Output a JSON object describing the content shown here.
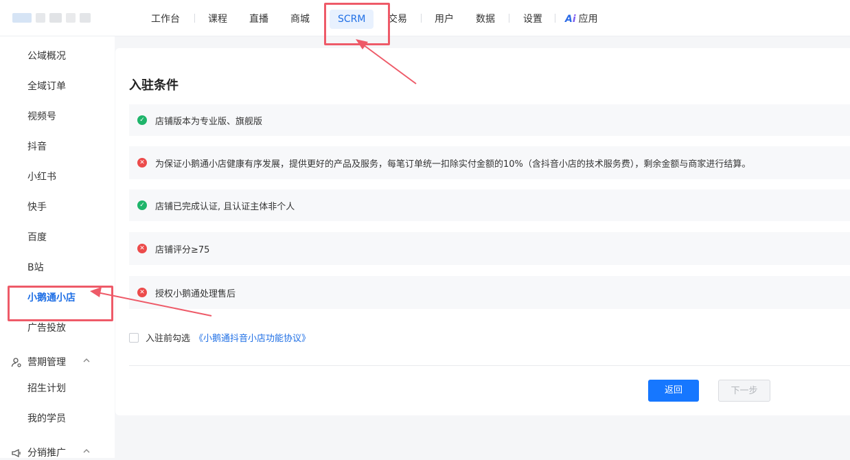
{
  "header": {
    "nav": [
      {
        "label": "工作台"
      },
      {
        "label": "课程"
      },
      {
        "label": "直播"
      },
      {
        "label": "商城"
      },
      {
        "label": "SCRM"
      },
      {
        "label": "交易"
      },
      {
        "label": "用户"
      },
      {
        "label": "数据"
      },
      {
        "label": "设置"
      },
      {
        "label": "应用"
      }
    ],
    "active_nav": "SCRM"
  },
  "sidebar": {
    "items": [
      {
        "label": "公域概况"
      },
      {
        "label": "全域订单"
      },
      {
        "label": "视频号"
      },
      {
        "label": "抖音"
      },
      {
        "label": "小红书"
      },
      {
        "label": "快手"
      },
      {
        "label": "百度"
      },
      {
        "label": "B站"
      },
      {
        "label": "小鹅通小店"
      },
      {
        "label": "广告投放"
      }
    ],
    "active_item": "小鹅通小店",
    "groups": [
      {
        "label": "营期管理",
        "children": [
          {
            "label": "招生计划"
          },
          {
            "label": "我的学员"
          }
        ]
      },
      {
        "label": "分销推广"
      }
    ]
  },
  "main": {
    "title": "入驻条件",
    "conditions": [
      {
        "text": "店铺版本为专业版、旗舰版",
        "status": "pass"
      },
      {
        "text": "为保证小鹅通小店健康有序发展，提供更好的产品及服务，每笔订单统一扣除实付金额的10%（含抖音小店的技术服务费），剩余金额与商家进行结算。",
        "status": "fail"
      },
      {
        "text": "店铺已完成认证, 且认证主体非个人",
        "status": "pass"
      },
      {
        "text": "店铺评分≥75",
        "status": "fail"
      },
      {
        "text": "授权小鹅通处理售后",
        "status": "fail"
      }
    ],
    "agreement": {
      "prefix": "入驻前勾选",
      "link": "《小鹅通抖音小店功能协议》",
      "checked": false
    },
    "buttons": {
      "back": "返回",
      "next": "下一步"
    }
  },
  "colors": {
    "accent": "#1677ff",
    "pass": "#1fb56b",
    "fail": "#ec4b4b",
    "annotation": "#ee5a68"
  }
}
